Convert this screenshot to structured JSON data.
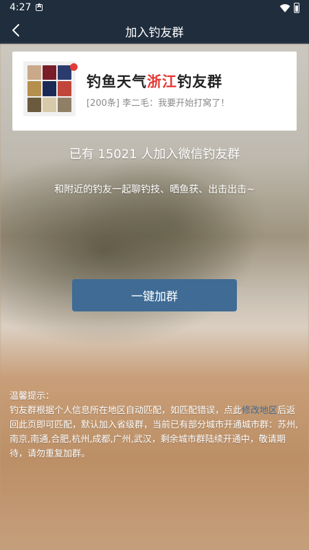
{
  "status_bar": {
    "time": "4:27"
  },
  "nav": {
    "title": "加入钓友群"
  },
  "group_card": {
    "name_before": "钓鱼天气",
    "name_highlight": "浙江",
    "name_after": "钓友群",
    "last_message": "[200条] 李二毛：我要开始打窝了！"
  },
  "info": {
    "joined_text": "已有 15021 人加入微信钓友群",
    "tagline": "和附近的钓友一起聊钓技、晒鱼获、出击出击~"
  },
  "join_button": {
    "label": "一键加群"
  },
  "tips": {
    "title": "温馨提示：",
    "text_before": "钓友群根据个人信息所在地区自动匹配，如匹配错误，点此",
    "link": "修改地区",
    "text_after": "后返回此页即可匹配，默认加入省级群，当前已有部分城市开通城市群：苏州,南京,南通,合肥,杭州,成都,广州,武汉，剩余城市群陆续开通中，敬请期待，请勿重复加群。"
  },
  "colors": {
    "header_bg": "#1f2d3d",
    "button_bg": "#3f6b95",
    "highlight": "#e53935",
    "link": "#3f6b95"
  }
}
